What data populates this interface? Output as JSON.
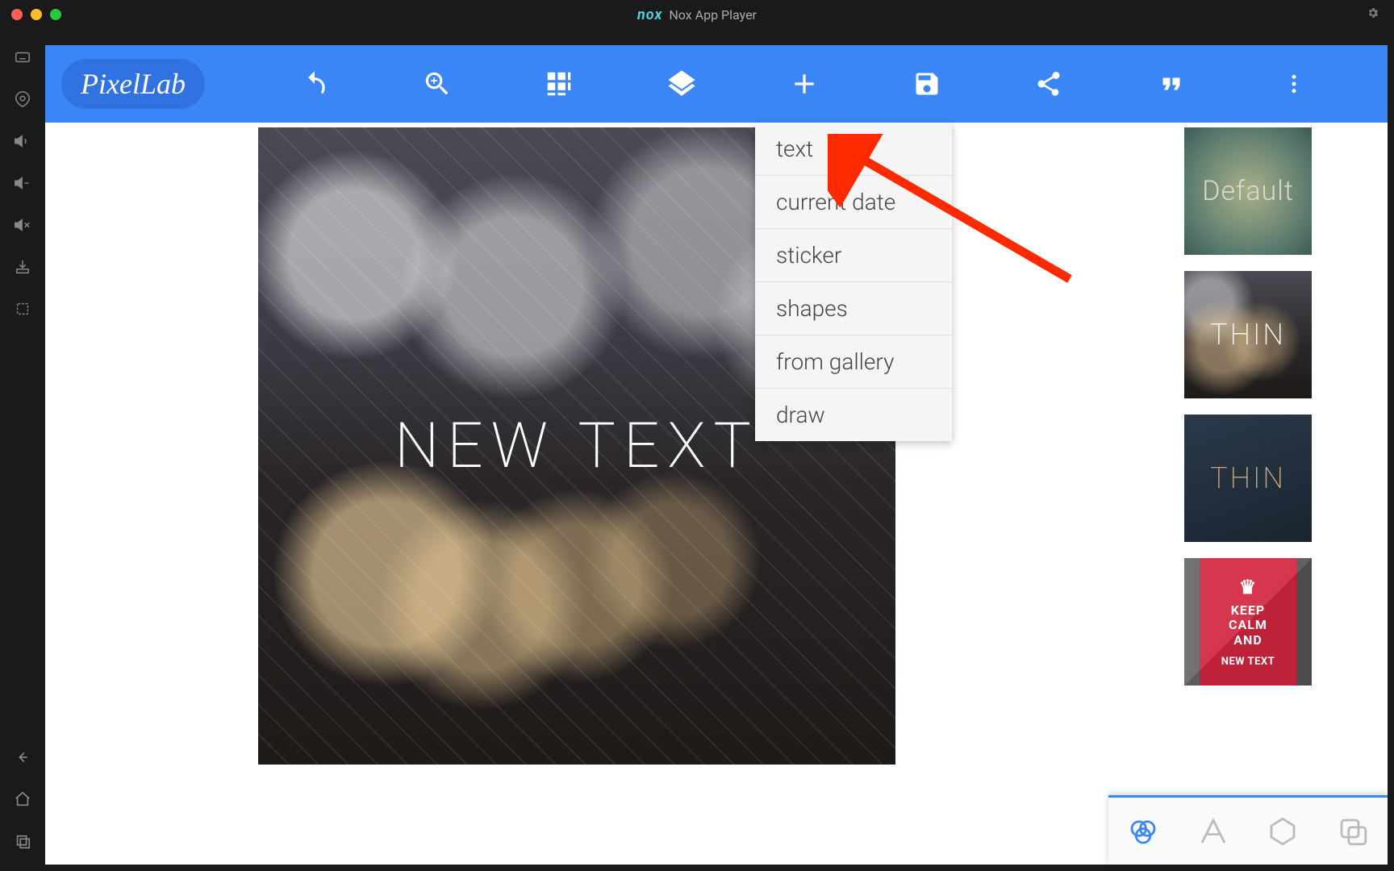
{
  "window": {
    "app_name": "Nox App Player",
    "logo_text": "nox"
  },
  "app": {
    "logo": "PixelLab",
    "toolbar_icons": [
      "undo",
      "zoom",
      "grid",
      "layers",
      "add",
      "save",
      "share",
      "quote",
      "overflow"
    ]
  },
  "canvas": {
    "text": "NEW TEXT"
  },
  "add_menu": {
    "items": [
      "text",
      "current date",
      "sticker",
      "shapes",
      "from gallery",
      "draw"
    ]
  },
  "templates": [
    {
      "id": "default",
      "label": "Default"
    },
    {
      "id": "thin1",
      "label": "THIN"
    },
    {
      "id": "thin2",
      "label": "THIN"
    },
    {
      "id": "keepcalm",
      "line1": "KEEP",
      "line2": "CALM",
      "line3": "AND",
      "sub": "NEW TEXT"
    }
  ],
  "bottom_tabs": [
    "blend",
    "text",
    "shape",
    "layers"
  ],
  "emulator_sidebar": [
    "keyboard",
    "location",
    "volume-up",
    "volume-down",
    "volume-mute",
    "install-apk",
    "screenshot",
    "back",
    "home",
    "recent"
  ],
  "colors": {
    "toolbar": "#3b86f7",
    "arrow": "#ff2a00"
  }
}
